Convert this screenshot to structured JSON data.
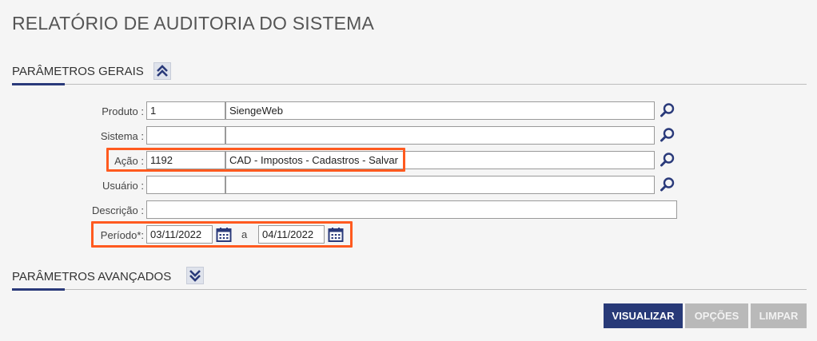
{
  "page": {
    "title": "RELATÓRIO DE AUDITORIA DO SISTEMA"
  },
  "sections": {
    "general": {
      "title": "PARÂMETROS GERAIS",
      "toggle_icon": "double-chevron-up-icon"
    },
    "advanced": {
      "title": "PARÂMETROS AVANÇADOS",
      "toggle_icon": "double-chevron-down-icon"
    }
  },
  "form": {
    "produto": {
      "label": "Produto :",
      "code": "1",
      "name": "SiengeWeb"
    },
    "sistema": {
      "label": "Sistema :",
      "code": "",
      "name": ""
    },
    "acao": {
      "label": "Ação :",
      "code": "1192",
      "name": "CAD - Impostos - Cadastros - Salvar"
    },
    "usuario": {
      "label": "Usuário :",
      "code": "",
      "name": ""
    },
    "descricao": {
      "label": "Descrição :",
      "value": ""
    },
    "periodo": {
      "label": "Período*:",
      "start": "03/11/2022",
      "separator": "a",
      "end": "04/11/2022"
    }
  },
  "buttons": {
    "visualizar": "VISUALIZAR",
    "opcoes": "OPÇÕES",
    "limpar": "LIMPAR"
  },
  "colors": {
    "primary": "#283a78",
    "highlight": "#ff5a1f",
    "disabled": "#b9b9b9",
    "accent": "#2a3a7a"
  },
  "icons": {
    "lookup": "magnifier-icon",
    "calendar": "calendar-icon"
  }
}
